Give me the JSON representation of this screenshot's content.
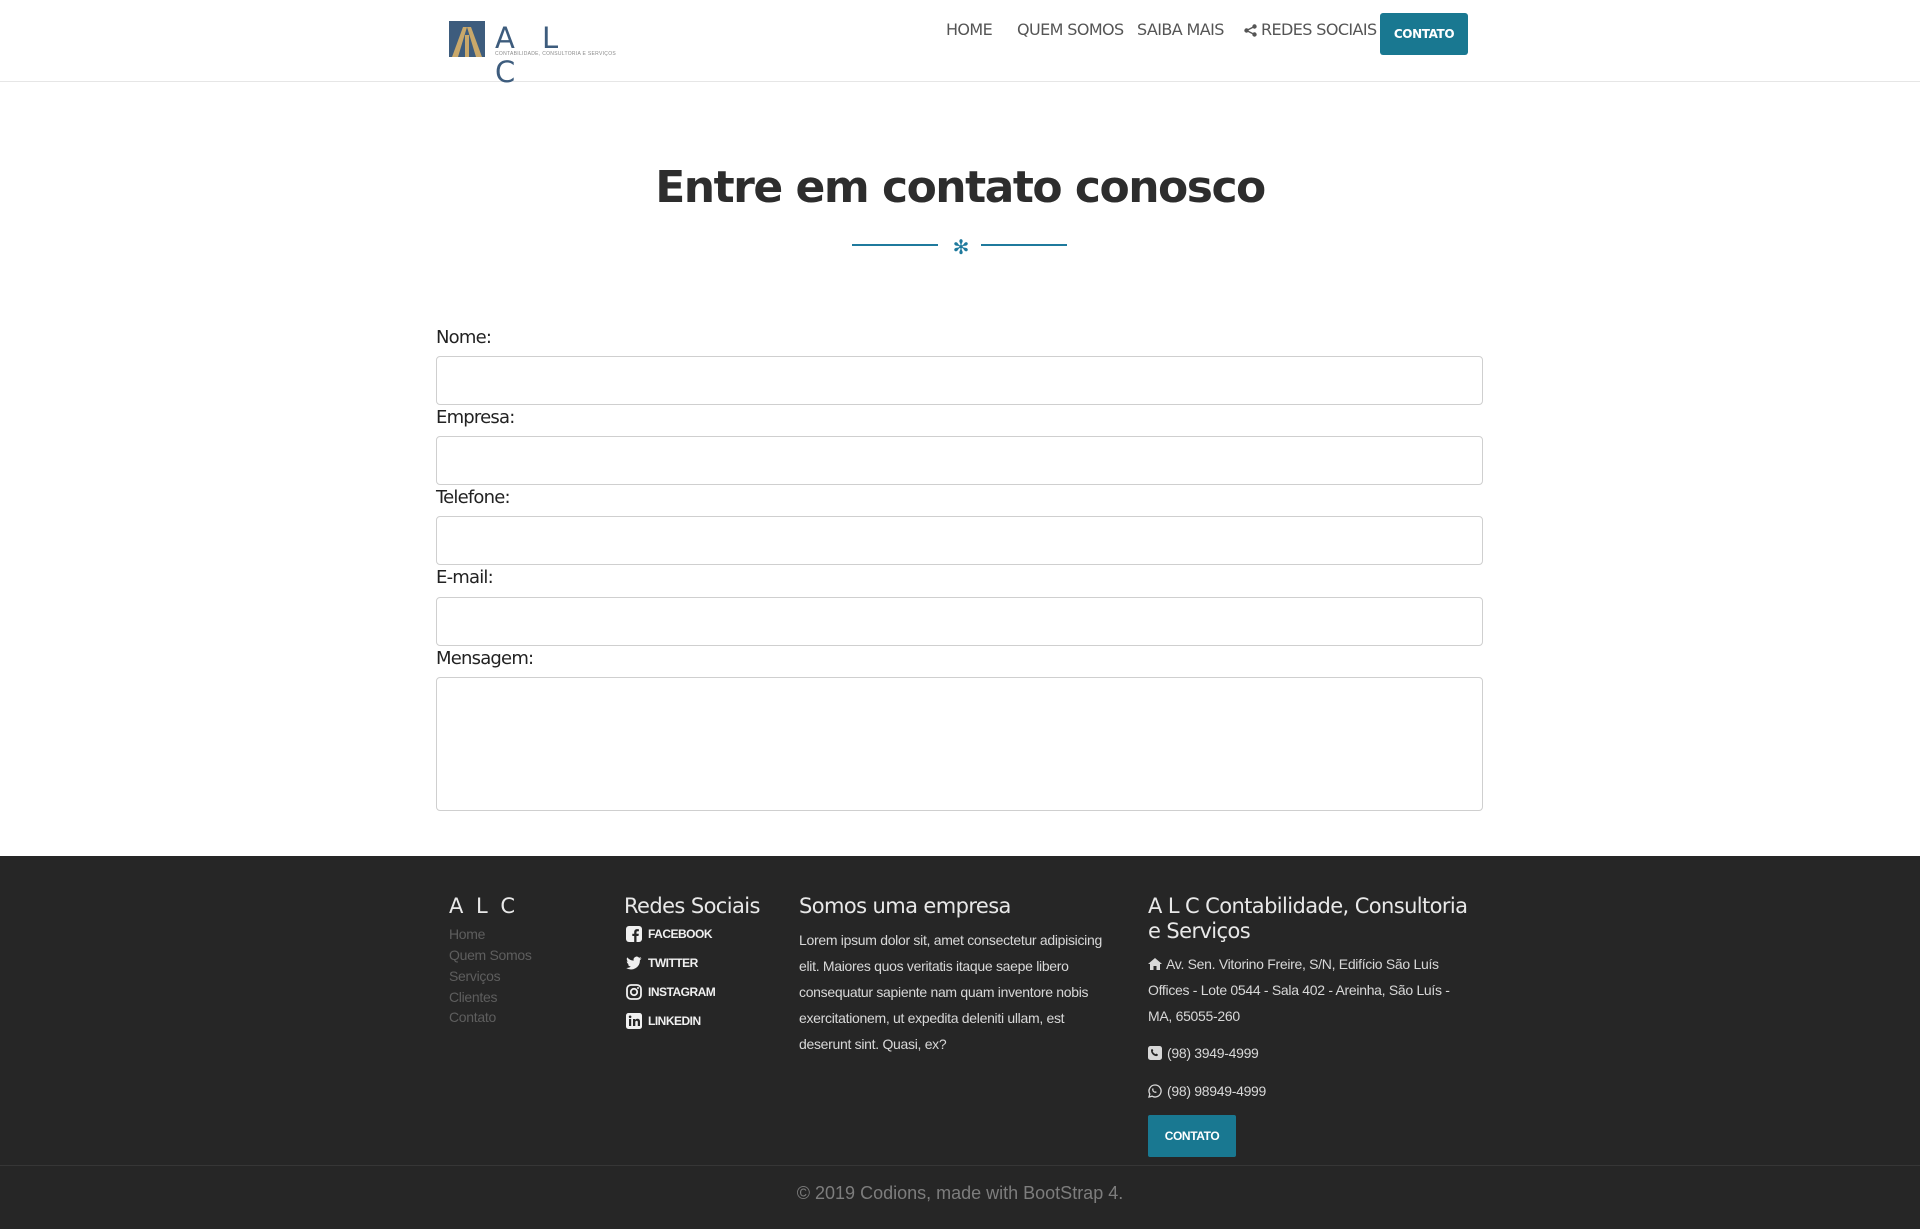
{
  "header": {
    "logo_text": "A L C",
    "logo_tagline": "CONTABILIDADE, CONSULTORIA E SERVIÇOS",
    "nav": [
      {
        "label": "HOME"
      },
      {
        "label": "QUEM SOMOS"
      },
      {
        "label": "SAIBA MAIS"
      },
      {
        "label": "REDES SOCIAIS",
        "icon": "share-icon"
      }
    ],
    "contact_button": "CONTATO",
    "accent_color": "#197891"
  },
  "main": {
    "title": "Entre em contato conosco",
    "divider_icon": "snowflake-icon",
    "form": {
      "fields": [
        {
          "label": "Nome:",
          "value": ""
        },
        {
          "label": "Empresa:",
          "value": ""
        },
        {
          "label": "Telefone:",
          "value": ""
        },
        {
          "label": "E-mail:",
          "value": ""
        },
        {
          "label": "Mensagem:",
          "value": ""
        }
      ]
    }
  },
  "footer": {
    "col1": {
      "title": "A L C",
      "links": [
        "Home",
        "Quem Somos",
        "Serviços",
        "Clientes",
        "Contato"
      ]
    },
    "col2": {
      "title": "Redes Sociais",
      "links": [
        {
          "label": "FACEBOOK",
          "icon": "facebook-icon"
        },
        {
          "label": "TWITTER",
          "icon": "twitter-icon"
        },
        {
          "label": "INSTAGRAM",
          "icon": "instagram-icon"
        },
        {
          "label": "LINKEDIN",
          "icon": "linkedin-icon"
        }
      ]
    },
    "col3": {
      "title": "Somos uma empresa",
      "text": "Lorem ipsum dolor sit, amet consectetur adipisicing elit. Maiores quos veritatis itaque saepe libero consequatur sapiente nam quam inventore nobis exercitationem, ut expedita deleniti ullam, est deserunt sint. Quasi, ex?"
    },
    "col4": {
      "title": "A L C Contabilidade, Consultoria e Serviços",
      "address": "Av. Sen. Vitorino Freire, S/N, Edifício São Luís Offices - Lote 0544 - Sala 402 - Areinha, São Luís - MA, 65055-260",
      "phone": "(98) 3949-4999",
      "whatsapp": "(98) 98949-4999",
      "button": "CONTATO"
    },
    "copyright": "© 2019 Codions, made with BootStrap 4."
  }
}
